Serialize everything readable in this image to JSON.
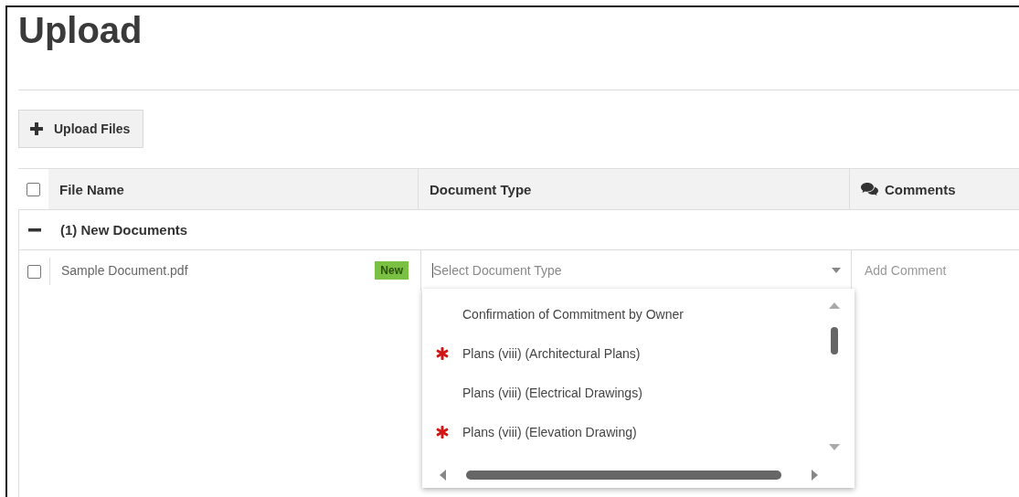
{
  "page": {
    "title": "Upload"
  },
  "upload_button": {
    "label": "Upload Files"
  },
  "table": {
    "select_all": {
      "checked": false
    },
    "columns": [
      {
        "label": "File Name",
        "kind": "text"
      },
      {
        "label": "Document Type",
        "kind": "text"
      },
      {
        "label": "Comments",
        "kind": "comments"
      }
    ],
    "groups": [
      {
        "label": "(1) New Documents",
        "expanded": true,
        "rows": [
          {
            "checked": false,
            "file_name": "Sample Document.pdf",
            "badge": "New",
            "document_type": {
              "placeholder": "Select Document Type",
              "open": true,
              "options": [
                {
                  "label": "Confirmation of Commitment by Owner",
                  "required": false
                },
                {
                  "label": "Plans (viii) (Architectural Plans)",
                  "required": true
                },
                {
                  "label": "Plans (viii) (Electrical Drawings)",
                  "required": false
                },
                {
                  "label": "Plans (viii) (Elevation Drawing)",
                  "required": true
                }
              ]
            },
            "comment": {
              "placeholder": "Add Comment"
            }
          }
        ]
      }
    ]
  }
}
